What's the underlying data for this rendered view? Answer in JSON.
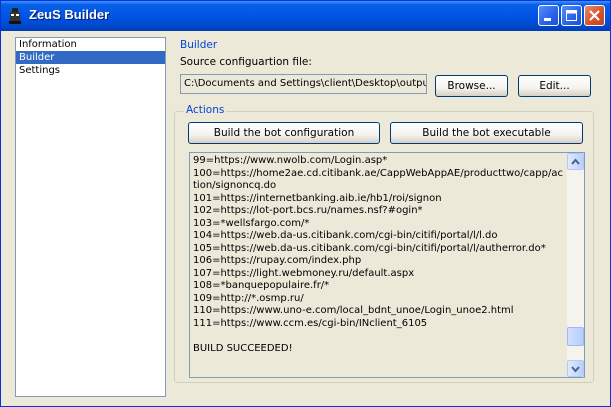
{
  "window": {
    "title": "ZeuS Builder",
    "icon": "zeus-app-icon",
    "controls": [
      "minimize-icon",
      "maximize-icon",
      "close-icon"
    ]
  },
  "nav": {
    "items": [
      {
        "label": "Information",
        "selected": false
      },
      {
        "label": "Builder",
        "selected": true
      },
      {
        "label": "Settings",
        "selected": false
      }
    ]
  },
  "builder": {
    "section_title": "Builder",
    "source_label": "Source configuartion file:",
    "source_path": "C:\\Documents and Settings\\client\\Desktop\\output",
    "browse_label": "Browse...",
    "edit_label": "Edit..."
  },
  "actions": {
    "section_title": "Actions",
    "build_config_label": "Build the bot configuration",
    "build_exe_label": "Build the bot executable"
  },
  "log": {
    "lines": [
      "99=https://www.nwolb.com/Login.asp*",
      "100=https://home2ae.cd.citibank.ae/CappWebAppAE/producttwo/capp/action/signoncq.do",
      "101=https://internetbanking.aib.ie/hb1/roi/signon",
      "102=https://lot-port.bcs.ru/names.nsf?#ogin*",
      "103=*wellsfargo.com/*",
      "104=https://web.da-us.citibank.com/cgi-bin/citifi/portal/l/l.do",
      "105=https://web.da-us.citibank.com/cgi-bin/citifi/portal/l/autherror.do*",
      "106=https://rupay.com/index.php",
      "107=https://light.webmoney.ru/default.aspx",
      "108=*banquepopulaire.fr/*",
      "109=http://*.osmp.ru/",
      "110=https://www.uno-e.com/local_bdnt_unoe/Login_unoe2.html",
      "111=https://www.ccm.es/cgi-bin/INclient_6105",
      "",
      "BUILD SUCCEEDED!"
    ],
    "scroll_position": 0.92
  }
}
